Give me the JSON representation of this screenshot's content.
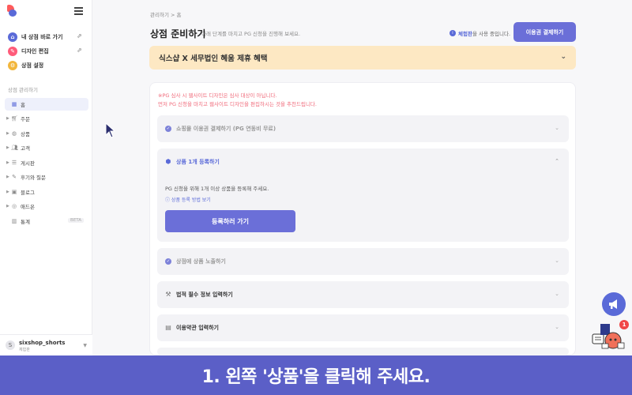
{
  "sidebar": {
    "quick_links": [
      {
        "label": "내 상점 바로 가기",
        "icon": "store-icon",
        "color": "#5a6ad8"
      },
      {
        "label": "디자인 편집",
        "icon": "pencil-icon",
        "color": "#ff5b7a"
      },
      {
        "label": "상점 설정",
        "icon": "gear-icon",
        "color": "#f2b63c"
      }
    ],
    "section_label": "상점 관리하기",
    "nav": [
      {
        "label": "홈",
        "icon": "grid-icon"
      },
      {
        "label": "주문",
        "icon": "cart-icon"
      },
      {
        "label": "상품",
        "icon": "box-icon"
      },
      {
        "label": "고객",
        "icon": "people-icon"
      },
      {
        "label": "게시판",
        "icon": "list-icon"
      },
      {
        "label": "후기와 질문",
        "icon": "pen-icon"
      },
      {
        "label": "블로그",
        "icon": "image-icon"
      },
      {
        "label": "애드온",
        "icon": "addon-icon"
      },
      {
        "label": "통계",
        "icon": "chart-icon",
        "badge": "BETA"
      }
    ],
    "account": {
      "avatar": "S",
      "name": "sixshop_shorts",
      "plan": "체험판"
    }
  },
  "header": {
    "breadcrumb": "관리하기 > 홈",
    "title": "상점 준비하기",
    "subtitle": "아래 단계를 마치고 PG 신청을 진행해 보세요.",
    "trial_prefix": "체험판",
    "trial_suffix": "을 사용 중입니다.",
    "pay_button": "이용권 결제하기"
  },
  "promo": {
    "text": "식스샵 X 세무법인 혜움 제휴 혜택"
  },
  "notice": {
    "line1": "※PG 심사 시 웹사이트 디자인은 심사 대상이 아닙니다.",
    "line2": "먼저 PG 신청을 마치고 웹사이트 디자인을 편집하시는 것을 추천드립니다."
  },
  "steps": [
    {
      "label": "쇼핑몰 이용권 결제하기 (PG 연동비 무료)",
      "state": "done"
    },
    {
      "label": "상품 1개 등록하기",
      "state": "open",
      "desc": "PG 신청을 위해 1개 이상 상품을 등록해 주세요.",
      "link": "상품 등록 방법 보기",
      "button": "등록하러 가기"
    },
    {
      "label": "상점에 상품 노출하기",
      "state": "done"
    },
    {
      "label": "법적 필수 정보 입력하기",
      "state": "todo"
    },
    {
      "label": "이용약관 입력하기",
      "state": "todo"
    }
  ],
  "floating": {
    "notification_count": "1"
  },
  "caption": "1. 왼쪽 '상품'을 클릭해 주세요.",
  "colors": {
    "primary": "#6b6fd8",
    "promo_bg": "#fde8c3",
    "notice": "#f06a7a",
    "caption_bg": "#5b5fc7"
  }
}
